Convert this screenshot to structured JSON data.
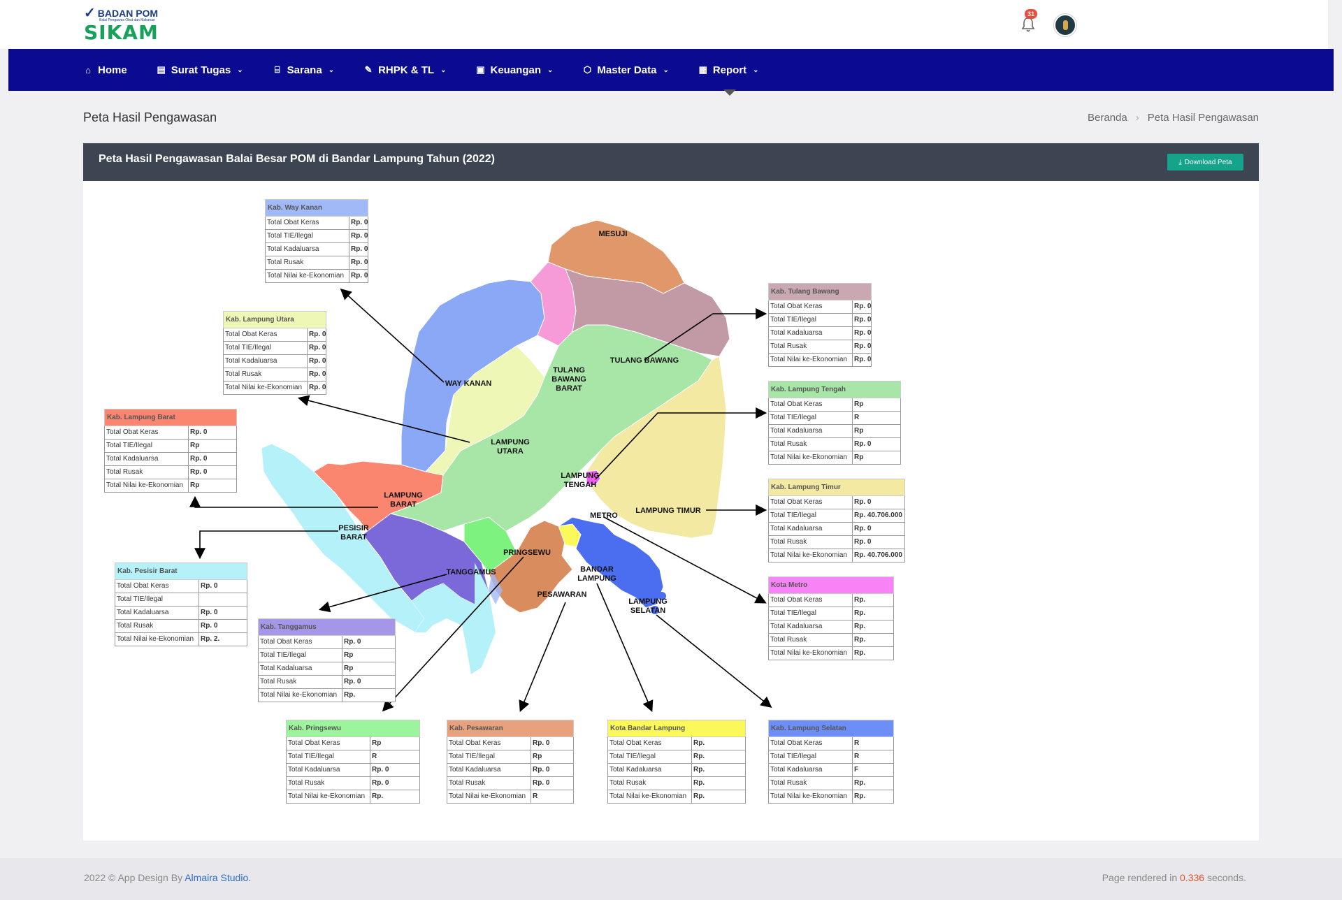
{
  "brand": {
    "agency": "BADAN POM",
    "tagline": "Balai Pengawas Obat dan Makanan",
    "app": "SIKAM"
  },
  "notifications": {
    "count": "31"
  },
  "nav": [
    {
      "label": "Home",
      "icon": "home-icon"
    },
    {
      "label": "Surat Tugas",
      "icon": "document-icon"
    },
    {
      "label": "Sarana",
      "icon": "building-icon"
    },
    {
      "label": "RHPK & TL",
      "icon": "edit-icon"
    },
    {
      "label": "Keuangan",
      "icon": "wallet-icon"
    },
    {
      "label": "Master Data",
      "icon": "cube-icon"
    },
    {
      "label": "Report",
      "icon": "report-icon"
    }
  ],
  "page": {
    "title": "Peta Hasil Pengawasan",
    "breadcrumb": [
      "Beranda",
      "Peta Hasil Pengawasan"
    ]
  },
  "card": {
    "title": "Peta Hasil Pengawasan Balai Besar POM di Bandar Lampung Tahun (2022)",
    "download_label": "Download Peta"
  },
  "row_labels": [
    "Total Obat Keras",
    "Total TIE/Ilegal",
    "Total Kadaluarsa",
    "Total Rusak",
    "Total Nilai ke-Ekonomian"
  ],
  "regions": [
    {
      "name": "Kab. Way Kanan",
      "color": "#a0b9f7",
      "values": [
        "Rp. 0",
        "Rp. 0",
        "Rp. 0",
        "Rp. 0",
        "Rp. 0"
      ]
    },
    {
      "name": "Kab. Lampung Utara",
      "color": "#eef7b5",
      "values": [
        "Rp. 0",
        "Rp. 0",
        "Rp. 0",
        "Rp. 0",
        "Rp. 0"
      ]
    },
    {
      "name": "Kab. Lampung Barat",
      "color": "#fb8670",
      "values": [
        "Rp. 0",
        "Rp",
        "Rp. 0",
        "Rp. 0",
        "Rp"
      ]
    },
    {
      "name": "Kab. Pesisir Barat",
      "color": "#b4f1f8",
      "values": [
        "Rp. 0",
        "",
        "Rp. 0",
        "Rp. 0",
        "Rp. 2."
      ]
    },
    {
      "name": "Kab. Tanggamus",
      "color": "#a596e8",
      "values": [
        "Rp. 0",
        "Rp",
        "Rp",
        "Rp. 0",
        "Rp."
      ]
    },
    {
      "name": "Kab. Pringsewu",
      "color": "#9cf59c",
      "values": [
        "Rp",
        "R",
        "Rp. 0",
        "Rp. 0",
        "Rp."
      ]
    },
    {
      "name": "Kab. Pesawaran",
      "color": "#e7a27d",
      "values": [
        "Rp. 0",
        "Rp",
        "Rp. 0",
        "Rp. 0",
        "R"
      ]
    },
    {
      "name": "Kota Bandar Lampung",
      "color": "#fbf95a",
      "values": [
        "Rp.",
        "Rp.",
        "Rp.",
        "Rp.",
        "Rp."
      ]
    },
    {
      "name": "Kab. Lampung Selatan",
      "color": "#6e8ef7",
      "values": [
        "R",
        "R",
        "F",
        "Rp.",
        "Rp."
      ]
    },
    {
      "name": "Kab. Tulang Bawang",
      "color": "#c9a8b2",
      "values": [
        "Rp. 0",
        "Rp. 0",
        "Rp. 0",
        "Rp. 0",
        "Rp. 0"
      ]
    },
    {
      "name": "Kab. Lampung Tengah",
      "color": "#a8e6a8",
      "values": [
        "Rp",
        "R",
        "Rp",
        "Rp. 0",
        "Rp"
      ]
    },
    {
      "name": "Kab. Lampung Timur",
      "color": "#f4e9a2",
      "values": [
        "Rp. 0",
        "Rp. 40.706.000",
        "Rp. 0",
        "Rp. 0",
        "Rp. 40.706.000"
      ]
    },
    {
      "name": "Kota Metro",
      "color": "#f783f7",
      "values": [
        "Rp.",
        "Rp.",
        "Rp.",
        "Rp.",
        "Rp."
      ]
    }
  ],
  "map_labels": {
    "mesuji": "MESUJI",
    "tulang_bawang": "TULANG BAWANG",
    "tulang_bawang_barat": [
      "TULANG",
      "BAWANG",
      "BARAT"
    ],
    "way_kanan": "WAY KANAN",
    "lampung_utara": [
      "LAMPUNG",
      "UTARA"
    ],
    "lampung_tengah": [
      "LAMPUNG",
      "TENGAH"
    ],
    "lampung_barat": [
      "LAMPUNG",
      "BARAT"
    ],
    "pesisir_barat": [
      "PESISIR",
      "BARAT"
    ],
    "lampung_timur": "LAMPUNG TIMUR",
    "metro": "METRO",
    "tanggamus": "TANGGAMUS",
    "pringsewu": "PRINGSEWU",
    "bandar_lampung": [
      "BANDAR",
      "LAMPUNG"
    ],
    "pesawaran": "PESAWARAN",
    "lampung_selatan": [
      "LAMPUNG",
      "SELATAN"
    ]
  },
  "footer": {
    "copyright": "2022 © App Design By",
    "studio": "Almaira Studio.",
    "rendered_prefix": "Page rendered in",
    "time": "0.336",
    "rendered_suffix": "seconds."
  }
}
